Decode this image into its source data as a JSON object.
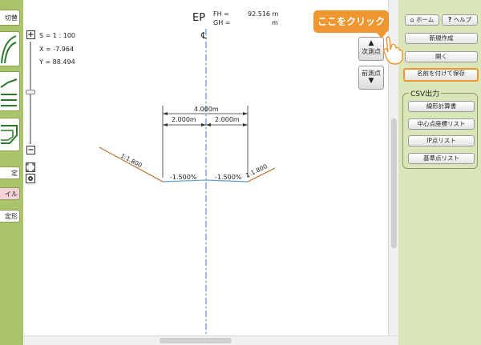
{
  "left_sidebar": {
    "items": [
      {
        "label": "切替",
        "icon": "toggle-text"
      },
      {
        "label": "",
        "icon": "curve-icon"
      },
      {
        "label": "",
        "icon": "lines-icon"
      },
      {
        "label": "",
        "icon": "cross-section-icon"
      },
      {
        "label": "定",
        "icon": ""
      },
      {
        "label": "イル",
        "icon": ""
      },
      {
        "label": "定形",
        "icon": ""
      }
    ]
  },
  "canvas": {
    "ep_label": "EP",
    "fh_label": "FH =",
    "fh_value": "92.516 m",
    "gh_label": "GH =",
    "gh_value": "m",
    "scale": "S = 1 : 100",
    "x_coord": "X = -7.964",
    "y_coord": "Y = 88.494",
    "centerline_symbol": "℄",
    "zoom_in": "+",
    "zoom_out": "−",
    "next_point": "次測点",
    "prev_point": "前測点"
  },
  "drawing": {
    "dim_total": "4.000m",
    "dim_left": "2.000m",
    "dim_right": "2.000m",
    "slope_left": "1:1.800",
    "slope_right": "1:1.800",
    "grade_left": "-1.500%",
    "grade_right": "-1.500%"
  },
  "right_panel": {
    "home": "ホーム",
    "help": "ヘルプ",
    "new": "新規作成",
    "open": "開く",
    "save_as": "名前を付けて保存",
    "csv_title": "CSV出力",
    "csv_buttons": [
      "線形計算書",
      "中心点座標リスト",
      "IP点リスト",
      "基準点リスト"
    ]
  },
  "callout": {
    "text": "ここをクリック"
  },
  "colors": {
    "sidebar_green": "#a9c46a",
    "panel_green": "#d9e6b8",
    "callout_orange": "#f09630",
    "slope_brown": "#b5651d",
    "road_blue": "#5aa0d0"
  }
}
